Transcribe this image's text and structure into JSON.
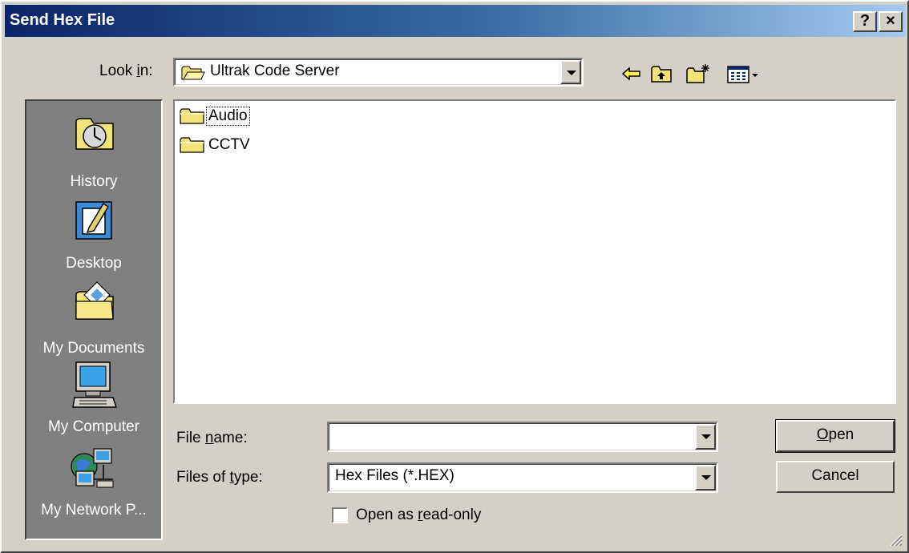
{
  "window": {
    "title": "Send Hex File",
    "help_label": "?",
    "close_label": "×"
  },
  "lookin": {
    "label_pre": "Look ",
    "label_u": "i",
    "label_post": "n:",
    "value": "Ultrak Code Server"
  },
  "places": [
    {
      "label": "History",
      "icon": "history-icon"
    },
    {
      "label": "Desktop",
      "icon": "desktop-icon"
    },
    {
      "label": "My Documents",
      "icon": "my-documents-icon"
    },
    {
      "label": "My Computer",
      "icon": "my-computer-icon"
    },
    {
      "label": "My Network P...",
      "icon": "my-network-places-icon"
    }
  ],
  "files": [
    {
      "name": "Audio",
      "icon": "folder-icon"
    },
    {
      "name": "CCTV",
      "icon": "folder-icon"
    }
  ],
  "filename": {
    "label_pre": "File ",
    "label_u": "n",
    "label_post": "ame:",
    "value": ""
  },
  "filetype": {
    "label_pre": "Files of ",
    "label_u": "t",
    "label_post": "ype:",
    "value": "Hex Files (*.HEX)"
  },
  "readonly": {
    "label_pre": "Open as ",
    "label_u": "r",
    "label_post": "ead-only"
  },
  "buttons": {
    "open_u": "O",
    "open_rest": "pen",
    "cancel": "Cancel"
  },
  "colors": {
    "title_start": "#0a246a",
    "title_end": "#a6caf0",
    "face": "#d4d0c8",
    "places_bg": "#808080"
  }
}
